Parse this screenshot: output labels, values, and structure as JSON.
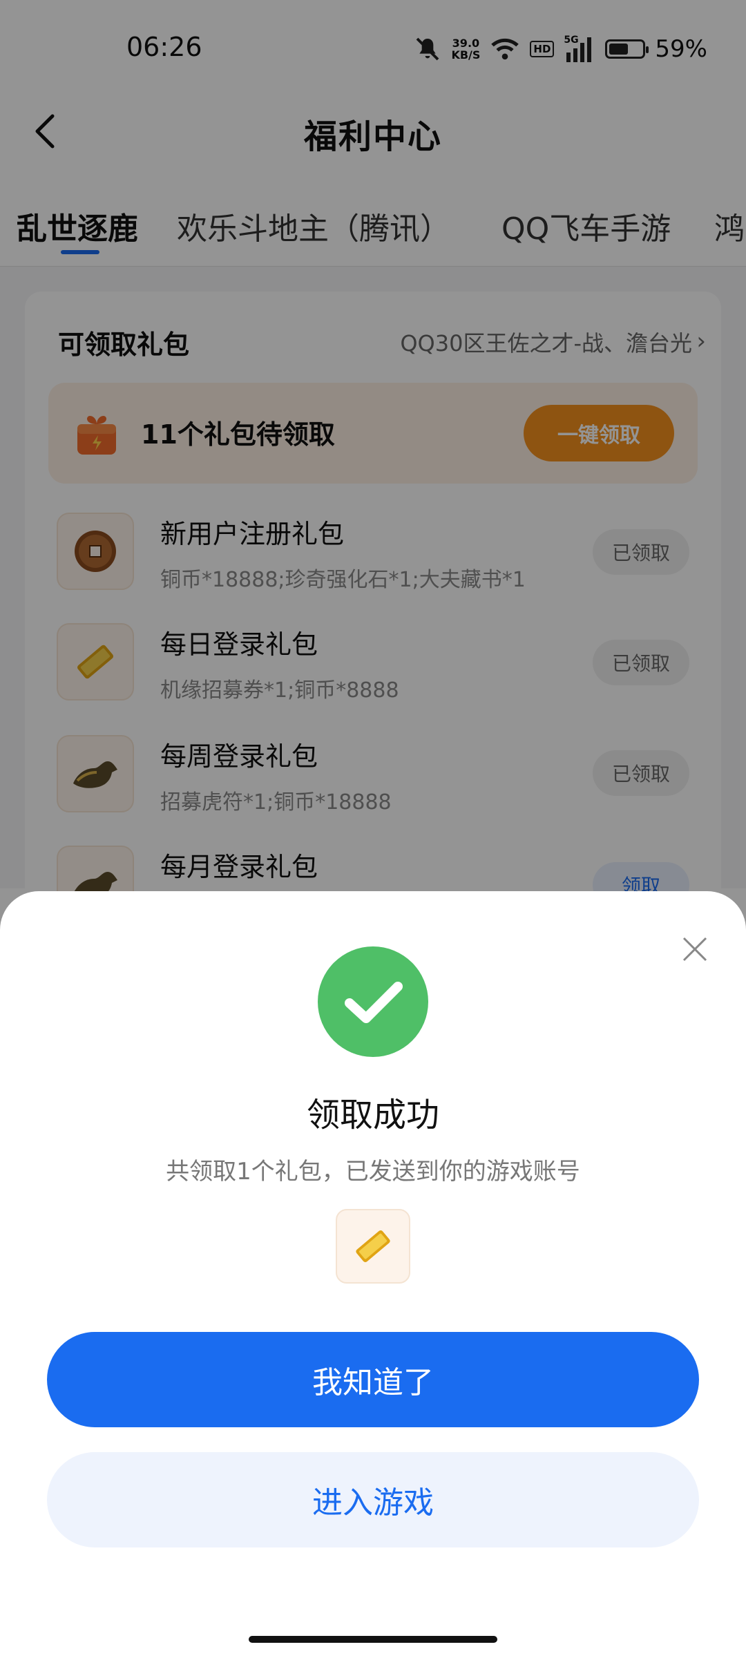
{
  "status_bar": {
    "time": "06:26",
    "net_speed_value": "39.0",
    "net_speed_unit": "KB/S",
    "hd": "HD",
    "signal_label": "5G",
    "battery_level": 0.59,
    "battery_pct": "59%"
  },
  "header": {
    "title": "福利中心",
    "back_icon": "chevron-left-icon"
  },
  "tabs": [
    {
      "label": "乱世逐鹿",
      "active": true
    },
    {
      "label": "欢乐斗地主（腾讯）",
      "active": false
    },
    {
      "label": "QQ飞车手游",
      "active": false
    },
    {
      "label": "鸿",
      "active": false
    }
  ],
  "gift_panel": {
    "title": "可领取礼包",
    "server": "QQ30区王佐之才-战、澹台光",
    "pending_text": "11个礼包待领取",
    "claim_all_label": "一键领取",
    "items": [
      {
        "name": "新用户注册礼包",
        "desc": "铜币*18888;珍奇强化石*1;大夫藏书*1",
        "status": "已领取",
        "icon": "copper-coin-icon"
      },
      {
        "name": "每日登录礼包",
        "desc": "机缘招募券*1;铜币*8888",
        "status": "已领取",
        "icon": "scroll-ticket-icon"
      },
      {
        "name": "每周登录礼包",
        "desc": "招募虎符*1;铜币*18888",
        "status": "已领取",
        "icon": "tiger-tally-icon"
      },
      {
        "name": "每月登录礼包",
        "desc": "",
        "status": "领取",
        "icon": "tiger-tally-icon"
      }
    ]
  },
  "dialog": {
    "title": "领取成功",
    "subtitle": "共领取1个礼包，已发送到你的游戏账号",
    "reward_icon": "scroll-ticket-icon",
    "ok_label": "我知道了",
    "enter_label": "进入游戏"
  },
  "colors": {
    "primary": "#1a6cf0",
    "orange": "#f5911e",
    "success": "#4fbf67"
  }
}
